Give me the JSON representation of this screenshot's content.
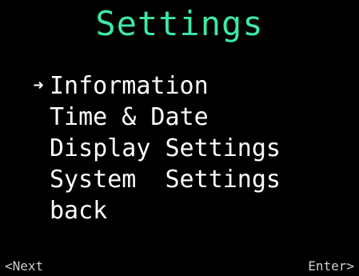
{
  "screen": {
    "title": "Settings",
    "title_color": "#3ee8a4",
    "background_color": "#000000",
    "text_color": "#ffffff"
  },
  "menu": {
    "selected_index": 0,
    "cursor_icon": "arrow-right-icon",
    "cursor_glyph": "➜",
    "items": [
      {
        "label": "Information"
      },
      {
        "label": "Time & Date"
      },
      {
        "label": "Display Settings"
      },
      {
        "label": "System  Settings"
      },
      {
        "label": "back"
      }
    ]
  },
  "footer": {
    "left_label": "<Next",
    "right_label": "Enter>"
  }
}
